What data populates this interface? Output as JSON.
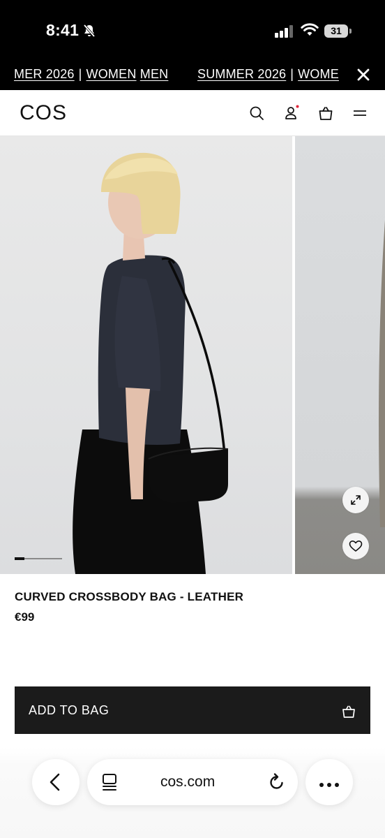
{
  "status_bar": {
    "time": "8:41",
    "battery": "31"
  },
  "banner": {
    "segments": [
      {
        "season": "MER 2026",
        "women": "WOMEN",
        "men": "MEN"
      },
      {
        "season": "SUMMER 2026",
        "women": "WOME"
      }
    ],
    "separator": "|"
  },
  "header": {
    "logo": "COS",
    "icons": [
      "search-icon",
      "account-icon",
      "bag-icon",
      "menu-icon"
    ],
    "account_dot_color": "#e0263a"
  },
  "gallery": {
    "progress": 0.2,
    "buttons": [
      "expand-icon",
      "heart-icon"
    ]
  },
  "product": {
    "name": "CURVED CROSSBODY BAG - LEATHER",
    "price": "€99"
  },
  "cta": {
    "label": "ADD TO BAG"
  },
  "browser": {
    "url": "cos.com"
  }
}
